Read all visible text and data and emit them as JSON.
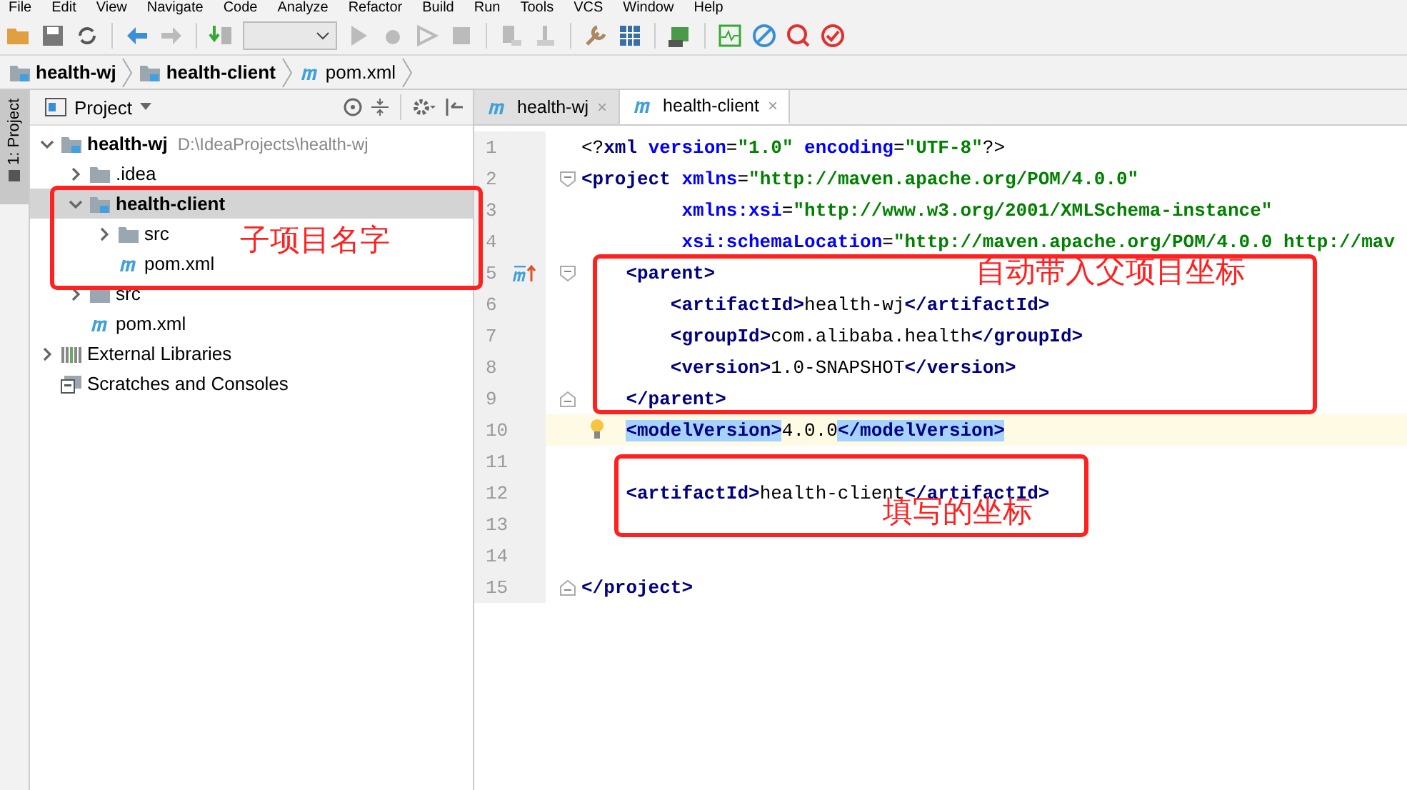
{
  "menu": [
    "File",
    "Edit",
    "View",
    "Navigate",
    "Code",
    "Analyze",
    "Refactor",
    "Build",
    "Run",
    "Tools",
    "VCS",
    "Window",
    "Help"
  ],
  "breadcrumbs": [
    {
      "kind": "module",
      "label": "health-wj"
    },
    {
      "kind": "module",
      "label": "health-client"
    },
    {
      "kind": "maven",
      "label": "pom.xml"
    }
  ],
  "tool_window_tab": {
    "label": "1: Project",
    "selected": true
  },
  "project_panel": {
    "title": "Project",
    "tree": [
      {
        "kind": "module",
        "label": "health-wj",
        "hint": "D:\\IdeaProjects\\health-wj",
        "expanded": true,
        "selected": false,
        "children": [
          {
            "kind": "folder",
            "label": ".idea",
            "expanded": false,
            "selected": false
          },
          {
            "kind": "module",
            "label": "health-client",
            "expanded": true,
            "selected": true,
            "children": [
              {
                "kind": "folder",
                "label": "src",
                "expanded": false,
                "selected": false
              },
              {
                "kind": "maven",
                "label": "pom.xml",
                "selected": false
              }
            ]
          },
          {
            "kind": "folder",
            "label": "src",
            "expanded": false,
            "selected": false
          },
          {
            "kind": "maven",
            "label": "pom.xml",
            "selected": false
          }
        ]
      },
      {
        "kind": "libraries",
        "label": "External Libraries",
        "expanded": false,
        "selected": false
      },
      {
        "kind": "scratches",
        "label": "Scratches and Consoles",
        "selected": false
      }
    ]
  },
  "editor_tabs": [
    {
      "label": "health-wj",
      "close": "×",
      "selected": false
    },
    {
      "label": "health-client",
      "close": "×",
      "selected": true
    }
  ],
  "lines": [
    {
      "number": "1",
      "current": false,
      "fold_start": false,
      "fold_end": false,
      "parent_marker": false,
      "intention_bulb": false,
      "segments": [
        {
          "kind": "text",
          "text": "<?"
        },
        {
          "kind": "tag",
          "text": "xml"
        },
        {
          "kind": "attr",
          "text": "version"
        },
        {
          "kind": "text",
          "text": "="
        },
        {
          "kind": "value",
          "text": "\"1.0\""
        },
        {
          "kind": "attr",
          "text": "encoding"
        },
        {
          "kind": "text",
          "text": "="
        },
        {
          "kind": "value",
          "text": "\"UTF-8\""
        },
        {
          "kind": "text",
          "text": "?>"
        }
      ]
    },
    {
      "number": "2",
      "current": false,
      "fold_start": true,
      "fold_end": false,
      "parent_marker": false,
      "intention_bulb": false,
      "segments": [
        {
          "kind": "tag",
          "text": "<project"
        },
        {
          "kind": "attr",
          "text": "xmlns"
        },
        {
          "kind": "text",
          "text": "="
        },
        {
          "kind": "value",
          "text": "\"http://maven.apache.org/POM/4.0.0\""
        }
      ]
    },
    {
      "number": "3",
      "current": false,
      "fold_start": false,
      "fold_end": false,
      "parent_marker": false,
      "intention_bulb": false,
      "segments": [
        {
          "kind": "attr",
          "text": "xmlns:xsi"
        },
        {
          "kind": "text",
          "text": "="
        },
        {
          "kind": "value",
          "text": "\"http://www.w3.org/2001/XMLSchema-instance\""
        }
      ]
    },
    {
      "number": "4",
      "current": false,
      "fold_start": false,
      "fold_end": false,
      "parent_marker": false,
      "intention_bulb": false,
      "segments": [
        {
          "kind": "attr",
          "text": "xsi:schemaLocation"
        },
        {
          "kind": "text",
          "text": "="
        },
        {
          "kind": "value",
          "text": "\"http://maven.apache.org/POM/4.0.0 http://mav"
        }
      ]
    },
    {
      "number": "5",
      "current": false,
      "fold_start": true,
      "fold_end": false,
      "parent_marker": true,
      "intention_bulb": false,
      "segments": [
        {
          "kind": "tag",
          "text": "<parent>"
        }
      ]
    },
    {
      "number": "6",
      "current": false,
      "fold_start": false,
      "fold_end": false,
      "parent_marker": false,
      "intention_bulb": false,
      "segments": [
        {
          "kind": "tag",
          "text": "<artifactId>"
        },
        {
          "kind": "text",
          "text": "health-wj"
        },
        {
          "kind": "tag",
          "text": "</artifactId>"
        }
      ]
    },
    {
      "number": "7",
      "current": false,
      "fold_start": false,
      "fold_end": false,
      "parent_marker": false,
      "intention_bulb": false,
      "segments": [
        {
          "kind": "tag",
          "text": "<groupId>"
        },
        {
          "kind": "text",
          "text": "com.alibaba.health"
        },
        {
          "kind": "tag",
          "text": "</groupId>"
        }
      ]
    },
    {
      "number": "8",
      "current": false,
      "fold_start": false,
      "fold_end": false,
      "parent_marker": false,
      "intention_bulb": false,
      "segments": [
        {
          "kind": "tag",
          "text": "<version>"
        },
        {
          "kind": "text",
          "text": "1.0-SNAPSHOT"
        },
        {
          "kind": "tag",
          "text": "</version>"
        }
      ]
    },
    {
      "number": "9",
      "current": false,
      "fold_start": false,
      "fold_end": true,
      "parent_marker": false,
      "intention_bulb": false,
      "segments": [
        {
          "kind": "tag",
          "text": "</parent>"
        }
      ]
    },
    {
      "number": "10",
      "current": true,
      "fold_start": false,
      "fold_end": false,
      "parent_marker": false,
      "intention_bulb": true,
      "segments": [
        {
          "kind": "tag",
          "text": "<modelVersion>",
          "highlighted": true
        },
        {
          "kind": "text",
          "text": "4.0.0",
          "highlighted": false
        },
        {
          "kind": "tag",
          "text": "</modelVersion>",
          "highlighted": true
        }
      ]
    },
    {
      "number": "11",
      "current": false,
      "fold_start": false,
      "fold_end": false,
      "parent_marker": false,
      "intention_bulb": false
    },
    {
      "number": "12",
      "current": false,
      "fold_start": false,
      "fold_end": false,
      "parent_marker": false,
      "intention_bulb": false,
      "segments": [
        {
          "kind": "tag",
          "text": "<artifactId>"
        },
        {
          "kind": "text",
          "text": "health-client"
        },
        {
          "kind": "tag",
          "text": "</artifactId>"
        }
      ]
    },
    {
      "number": "13",
      "current": false,
      "fold_start": false,
      "fold_end": false,
      "parent_marker": false,
      "intention_bulb": false
    },
    {
      "number": "14",
      "current": false,
      "fold_start": false,
      "fold_end": false,
      "parent_marker": false,
      "intention_bulb": false
    },
    {
      "number": "15",
      "current": false,
      "fold_start": false,
      "fold_end": true,
      "parent_marker": false,
      "intention_bulb": false,
      "segments": [
        {
          "kind": "tag",
          "text": "</project>"
        }
      ]
    }
  ],
  "annotations": [
    {
      "kind": "tree",
      "text": "子项目名字"
    },
    {
      "kind": "parent",
      "text": "自动带入父项目坐标"
    },
    {
      "kind": "artifact",
      "text": "填写的坐标"
    }
  ]
}
